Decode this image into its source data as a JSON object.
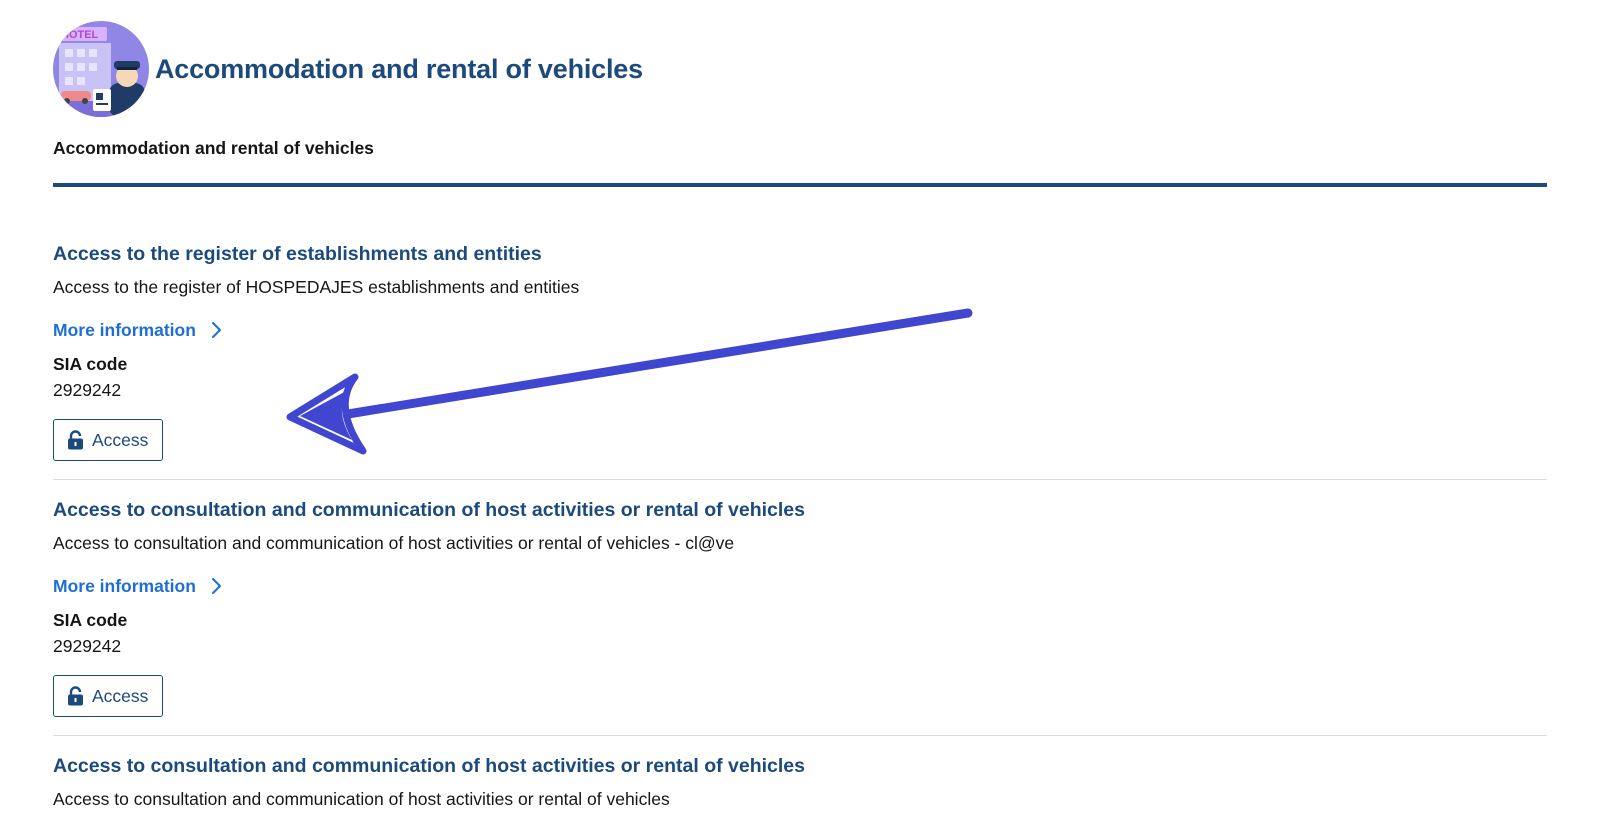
{
  "header": {
    "title": "Accommodation and rental of vehicles",
    "logo_icon": "hotel-receptionist-icon",
    "logo_sign_text": "HOTEL"
  },
  "subtitle": "Accommodation and rental of vehicles",
  "colors": {
    "primary": "#1d4a7c",
    "link": "#1e6fd4",
    "annotation_arrow": "#4146d0"
  },
  "procedures": [
    {
      "title": "Access to the register of establishments and entities",
      "description": "Access to the register of HOSPEDAJES establishments and entities",
      "more_info_label": "More information",
      "sia_label": "SIA code",
      "sia_value": "2929242",
      "access_label": "Access"
    },
    {
      "title": "Access to consultation and communication of host activities or rental of vehicles",
      "description": "Access to consultation and communication of host activities or rental of vehicles - cl@ve",
      "more_info_label": "More information",
      "sia_label": "SIA code",
      "sia_value": "2929242",
      "access_label": "Access"
    },
    {
      "title": "Access to consultation and communication of host activities or rental of vehicles",
      "description": "Access to consultation and communication of host activities or rental of vehicles"
    }
  ]
}
